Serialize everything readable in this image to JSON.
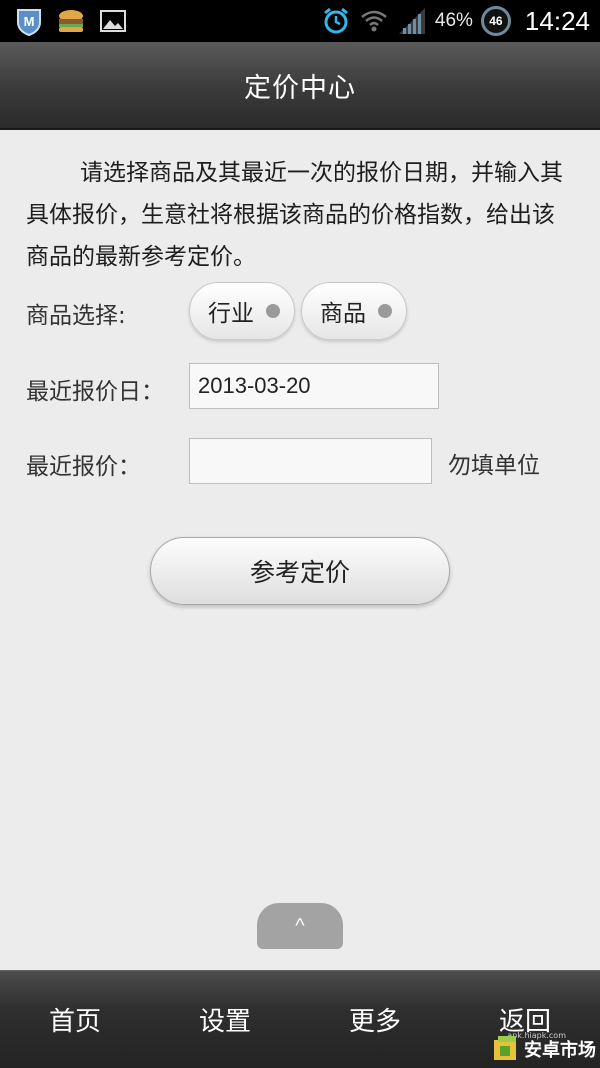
{
  "status_bar": {
    "battery_percent": "46%",
    "battery_badge": "46",
    "time": "14:24",
    "left_icons": [
      "m-shield-icon",
      "hamburger-app-icon",
      "image-icon"
    ],
    "right_icons": [
      "alarm-icon",
      "wifi-icon",
      "signal-icon"
    ]
  },
  "header": {
    "title": "定价中心"
  },
  "intro_text": "请选择商品及其最近一次的报价日期，并输入其具体报价，生意社将根据该商品的价格指数，给出该商品的最新参考定价。",
  "form": {
    "product_label": "商品选择:",
    "industry_button": "行业",
    "product_button": "商品",
    "date_label": "最近报价日：",
    "date_value": "2013-03-20",
    "price_label": "最近报价：",
    "price_value": "",
    "unit_hint": "勿填单位",
    "submit_label": "参考定价"
  },
  "expand_tab": "^",
  "bottom_nav": {
    "items": [
      {
        "label": "首页"
      },
      {
        "label": "设置"
      },
      {
        "label": "更多"
      },
      {
        "label": "返回"
      }
    ]
  },
  "watermark": {
    "small": "apk.hiapk.com",
    "main": "安卓市场"
  },
  "colors": {
    "alarm": "#2fb8e8",
    "background": "#ececec",
    "titlebar": "#3a3a3a"
  }
}
